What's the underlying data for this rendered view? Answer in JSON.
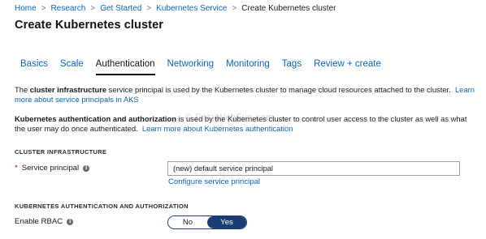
{
  "breadcrumb": {
    "items": [
      "Home",
      "Research",
      "Get Started",
      "Kubernetes Service"
    ],
    "current": "Create Kubernetes cluster",
    "separator": ">"
  },
  "page_title": "Create Kubernetes cluster",
  "tabs": [
    {
      "label": "Basics",
      "active": false
    },
    {
      "label": "Scale",
      "active": false
    },
    {
      "label": "Authentication",
      "active": true
    },
    {
      "label": "Networking",
      "active": false
    },
    {
      "label": "Monitoring",
      "active": false
    },
    {
      "label": "Tags",
      "active": false
    },
    {
      "label": "Review + create",
      "active": false
    }
  ],
  "para1": {
    "pre": "The ",
    "bold": "cluster infrastructure",
    "post": " service principal is used by the Kubernetes cluster to manage cloud resources attached to the cluster.",
    "link": "Learn more about service principals in AKS"
  },
  "para2": {
    "bold": "Kubernetes authentication and authorization",
    "post": " is used by the Kubernetes cluster to control user access to the cluster as well as what the user may do once authenticated.",
    "link": "Learn more about Kubernetes authentication"
  },
  "watermark": "© EasyWebFun.com",
  "sections": {
    "infrastructure": "CLUSTER INFRASTRUCTURE",
    "auth": "KUBERNETES AUTHENTICATION AND AUTHORIZATION"
  },
  "service_principal": {
    "required_mark": "*",
    "label": "Service principal",
    "value": "(new) default service principal",
    "configure_link": "Configure service principal"
  },
  "rbac": {
    "label": "Enable RBAC",
    "no_label": "No",
    "yes_label": "Yes",
    "selected": "Yes"
  },
  "colors": {
    "link": "#0a66b8",
    "toggle_active": "#1c3d73",
    "required": "#c00000"
  },
  "icons": {
    "info": "info-icon"
  }
}
